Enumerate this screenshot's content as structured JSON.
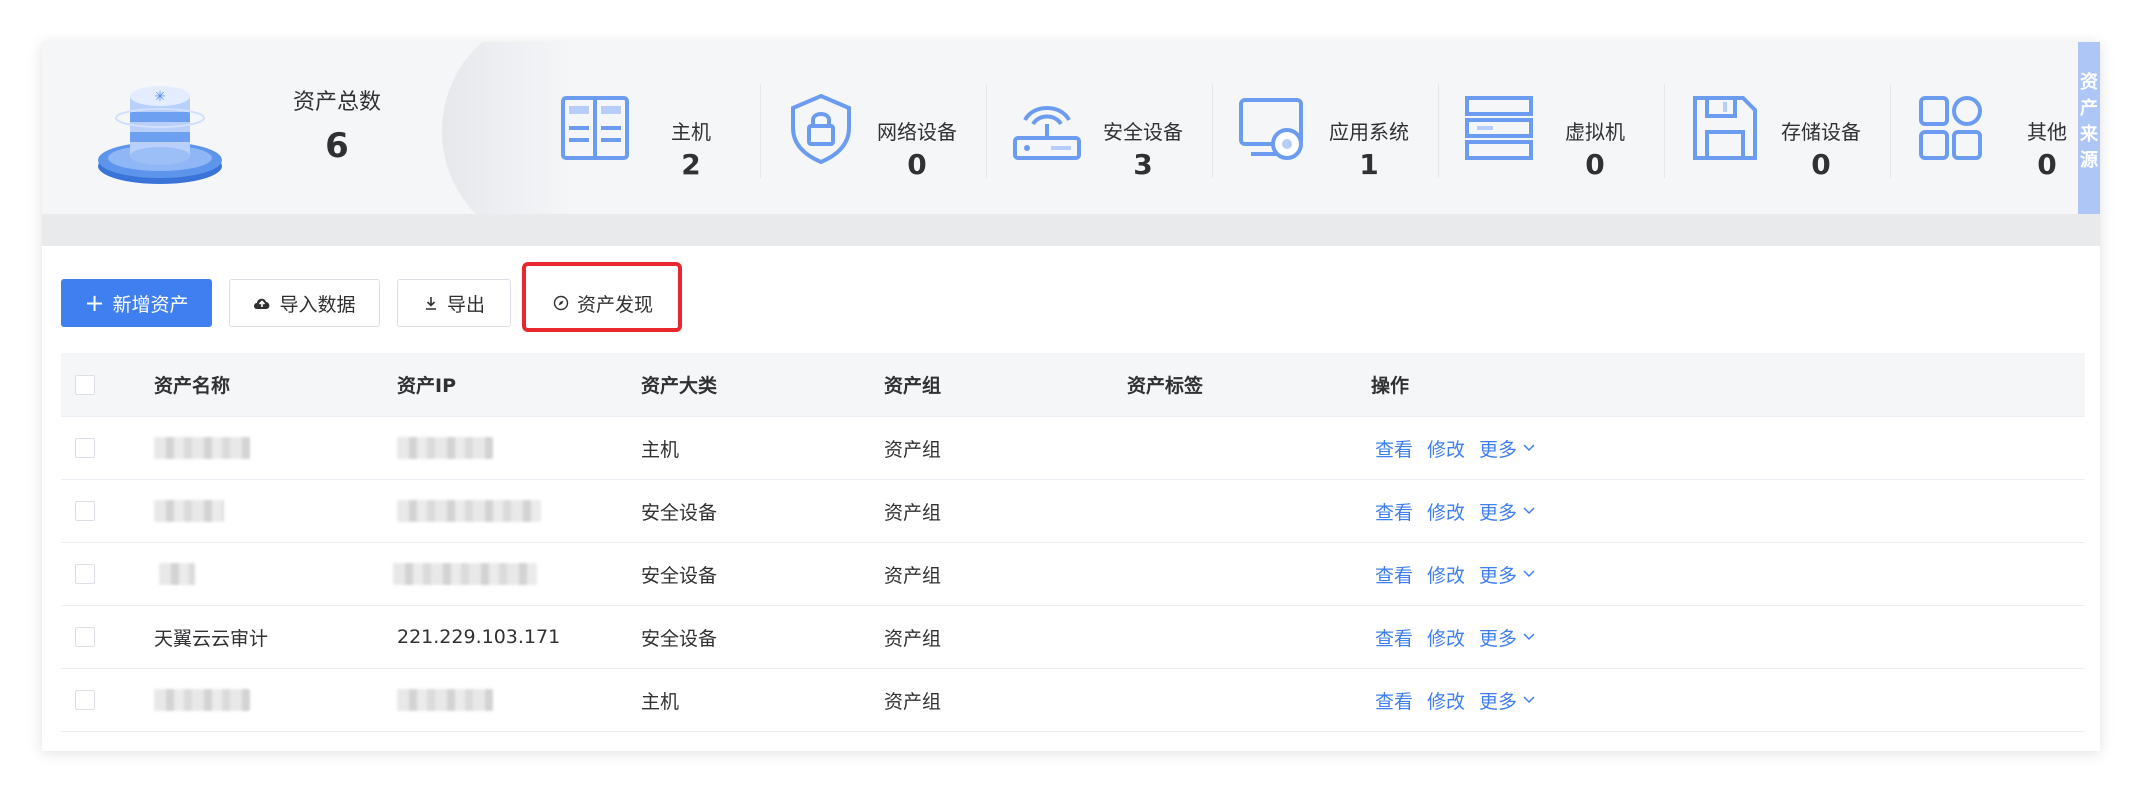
{
  "summary": {
    "total_label": "资产总数",
    "total_value": "6",
    "categories": [
      {
        "label": "主机",
        "value": "2",
        "icon": "server-icon"
      },
      {
        "label": "网络设备",
        "value": "0",
        "icon": "shield-lock-icon"
      },
      {
        "label": "安全设备",
        "value": "3",
        "icon": "router-icon"
      },
      {
        "label": "应用系统",
        "value": "1",
        "icon": "monitor-gear-icon"
      },
      {
        "label": "虚拟机",
        "value": "0",
        "icon": "rack-icon"
      },
      {
        "label": "存储设备",
        "value": "0",
        "icon": "floppy-icon"
      },
      {
        "label": "其他",
        "value": "0",
        "icon": "grid-icon"
      }
    ],
    "side_tab": "资产来源"
  },
  "toolbar": {
    "add_label": "新增资产",
    "import_label": "导入数据",
    "export_label": "导出",
    "discover_label": "资产发现"
  },
  "table": {
    "columns": [
      "资产名称",
      "资产IP",
      "资产大类",
      "资产组",
      "资产标签",
      "操作"
    ],
    "rows": [
      {
        "name": "",
        "ip": "",
        "category": "主机",
        "group": "资产组",
        "tags": ""
      },
      {
        "name": "",
        "ip": "",
        "category": "安全设备",
        "group": "资产组",
        "tags": ""
      },
      {
        "name": "",
        "ip": "",
        "category": "安全设备",
        "group": "资产组",
        "tags": ""
      },
      {
        "name": "天翼云云审计",
        "ip": "221.229.103.171",
        "category": "安全设备",
        "group": "资产组",
        "tags": ""
      },
      {
        "name": "",
        "ip": "",
        "category": "主机",
        "group": "资产组",
        "tags": ""
      }
    ],
    "actions": {
      "view": "查看",
      "edit": "修改",
      "more": "更多"
    }
  },
  "colors": {
    "accent": "#3f7ff0",
    "highlight": "#e8282e",
    "icon": "#6c9cf0"
  }
}
